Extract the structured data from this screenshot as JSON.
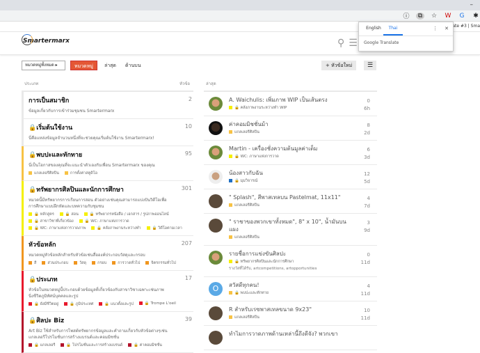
{
  "browser": {
    "minimize": "–",
    "bookmark_text": "ollgate #3 | Sma",
    "icons": [
      "info-icon",
      "translate-icon",
      "star-icon",
      "w-extension-icon",
      "translate-extension-icon",
      "puzzle-icon"
    ]
  },
  "translate_popup": {
    "tab_english": "English",
    "tab_thai": "Thai",
    "menu": "⋮",
    "close": "✕",
    "footer": "Google Translate"
  },
  "header": {
    "logo": "Smartermarx"
  },
  "nav": {
    "dropdown": "หมวดหมู่ทั้งหมด ▸",
    "tabs": [
      "หมวดหมู่",
      "ล่าสุด",
      "ด้านบน"
    ],
    "new_topic": "หัวข้อใหม่",
    "new_topic_icon": "+",
    "menu_icon": "☰"
  },
  "columns": {
    "category": "ประเภท",
    "topics": "หัวข้อ",
    "latest": "ล่าสุด"
  },
  "categories": [
    {
      "name": "การเป็นสมาชิก",
      "count": "2",
      "color": "#e9e9e9",
      "desc": "ข้อมูลเกี่ยวกับการเข้าร่วมชุมชน Smartermarx",
      "subs": []
    },
    {
      "name": "🔒เริ่มต้นใช้งาน",
      "count": "10",
      "color": "#e9e9e9",
      "desc": "นี่คือแหล่งข้อมูลจำนวนหนึ่งที่จะช่วยคุณเริ่มต้นใช้งาน Smartermarx!",
      "subs": []
    },
    {
      "name": "🔒พบปะและทักทาย",
      "count": "95",
      "color": "#f7c244",
      "desc": "นี่เป็นโอกาสของคุณที่จะแนะนำตัวเองกับเพื่อน Smartermarx ของคุณ",
      "subs": [
        "แกลเลอรีศิลปิน",
        "การตั้งค่าสตูดิโอ"
      ]
    },
    {
      "name": "🔒ทรัพยากรศิลปินและนักการศึกษา",
      "count": "301",
      "color": "#f5f000",
      "desc": "หมวดนี้มีทรัพยากรการเรียนการสอน ตัวอย่างเช่นคุณสามารถแบ่งปันวิดีโอเพื่อการศึกษาแบบฝึกหัดและบทความกับชุมชน",
      "subs": [
        "🔒 หลักสูตร",
        "🔒 สอน",
        "🔒 ทรัพยากรหนังสือ / เอกสาร / รูปภาพออนไลน์",
        "🔒 สาขาวิชาที่เกี่ยวข้อง",
        "🔒 WC: ภาษาแห่งการวาด",
        "🔒 WC: ภาษาแห่งการวาดภาพ",
        "🔒 คลังภาพงานระหว่างทำ",
        "🔒 วิดีโอตามเวลา"
      ]
    },
    {
      "name": "หัวข้อหลัก",
      "count": "207",
      "color": "#f0961f",
      "desc": "หมวดหมู่หัวข้อหลักสำหรับหัวข้อเช่นสื่อองค์ประกอบวัสดุและกรอบ",
      "subs": [
        "สี",
        "ส่วนประกอบ",
        "วัสดุ",
        "กรอบ",
        "การวาดทั่วไป",
        "จิตรกรรมทั่วไป"
      ]
    },
    {
      "name": "🔒ประเภท",
      "count": "17",
      "color": "#e8192c",
      "desc": "หัวข้อในหมวดหมู่นี้ประกอบด้วยข้อมูลที่เกี่ยวข้องกับสาขาวิชาเฉพาะเช่นภาพนิ่งชีวิตภูมิทัศน์บุคคลและรูป",
      "subs": [
        "🔒 ยังมีชีวิตอยู่",
        "🔒 ภูมิประเทศ",
        "🔒 แนวตั้งและรูป",
        "🔒 Trompe L'oeil"
      ]
    },
    {
      "name": "🔒ศิลปะ Biz",
      "count": "39",
      "color": "#b3122b",
      "desc": "Art Biz ใช้สำหรับการโพสต์ทรัพยากรข้อมูลและคำถามเกี่ยวกับหัวข้อต่างๆเช่นแกลเลอรีโปรโมชั่นการสร้างแบรนด์และคอมมิชชั่น",
      "subs": [
        "🔒 แกลเลอรี",
        "🔒 โปรโมชั่นและการสร้างแบรนด์",
        "🔒 ค่าคอมมิชชั่น"
      ]
    }
  ],
  "topics": [
    {
      "title": "A. Waichulis: เพิ่มภาพ WIP เป็นเส้นตรง",
      "cat": "🔒 คลังภาพงานระหว่างทำ WIP",
      "color": "#f5f000",
      "tags": "",
      "replies": "0",
      "age": "6h",
      "avatar": "g"
    },
    {
      "title": "ค่าคอมมิชชั่นม้า",
      "cat": "แกลเลอรีศิลปิน",
      "color": "#f7c244",
      "tags": "",
      "replies": "8",
      "age": "2d",
      "avatar": "b"
    },
    {
      "title": "Martin - เครื่องชั่งความต้นมูลค่าเต็ม",
      "cat": "🔒 WC: ภาษาแห่งการวาด",
      "color": "#f5f000",
      "tags": "",
      "replies": "6",
      "age": "3d",
      "avatar": "g"
    },
    {
      "title": "น้องสาวกับฉัน",
      "cat": "🔒 มุมวิจารณ์",
      "color": "#1f6fc2",
      "tags": "",
      "replies": "12",
      "age": "5d",
      "avatar": "w"
    },
    {
      "title": "\" Splash\", สีพาสเทลบน Pastelmat, 11x11\"",
      "cat": "แกลเลอรีศิลปิน",
      "color": "#f7c244",
      "tags": "",
      "replies": "4",
      "age": "7d",
      "avatar": ""
    },
    {
      "title": "\" ราชาของพวกเขาทั้งหมด\", 8\" x 10\", น้ำมันบนแผง",
      "cat": "แกลเลอรีศิลปิน",
      "color": "#f7c244",
      "tags": "",
      "replies": "3",
      "age": "9d",
      "avatar": ""
    },
    {
      "title": "รายชื่อการแข่งขันศิลปะ",
      "cat": "🔒 ทรัพยากรศิลปินและนักการศึกษา",
      "color": "#f5f000",
      "tags": "รางวัลที่ได้รับ, artcompetitions, artopportunities",
      "replies": "0",
      "age": "11d",
      "avatar": "g"
    },
    {
      "title": "สวัสดีทุกคน!",
      "cat": "🔒 พบปะและทักทาย",
      "color": "#f7c244",
      "tags": "",
      "replies": "4",
      "age": "11d",
      "avatar": "o",
      "avatar_letter": "O"
    },
    {
      "title": "R สำหรับเรซพาสเทลขนาด 9x23\"",
      "cat": "แกลเลอรีศิลปิน",
      "color": "#f7c244",
      "tags": "",
      "replies": "10",
      "age": "11d",
      "avatar": ""
    },
    {
      "title": "ทำไมการวาดภาพด้านเหล่านี้ถึงดีจัง? พวกเขา",
      "cat": "",
      "color": "#f7c244",
      "tags": "",
      "replies": "",
      "age": "",
      "avatar": ""
    }
  ]
}
